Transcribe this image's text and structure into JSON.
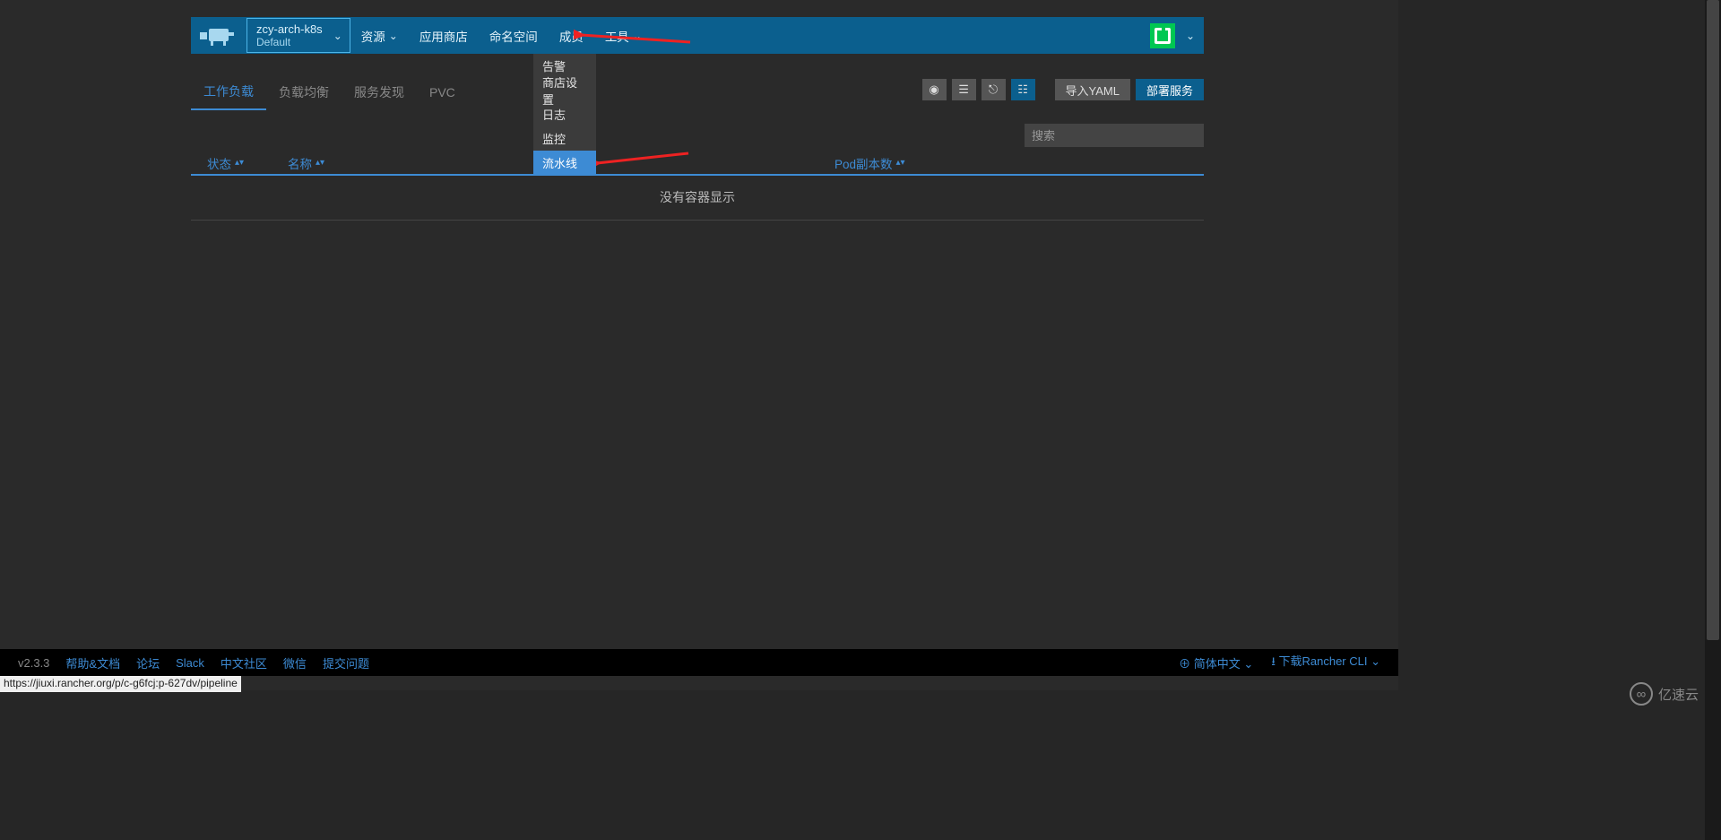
{
  "header": {
    "cluster_name": "zcy-arch-k8s",
    "cluster_sub": "Default",
    "nav": {
      "resources": "资源",
      "app_store": "应用商店",
      "namespace": "命名空间",
      "members": "成员",
      "tools": "工具"
    }
  },
  "tools_dropdown": {
    "alert": "告警",
    "store_settings": "商店设置",
    "logs": "日志",
    "monitor": "监控",
    "pipeline": "流水线"
  },
  "tabs": {
    "workload": "工作负载",
    "load_balance": "负载均衡",
    "service_discovery": "服务发现",
    "pvc": "PVC"
  },
  "actions": {
    "import_yaml": "导入YAML",
    "deploy": "部署服务"
  },
  "search": {
    "placeholder": "搜索"
  },
  "table": {
    "col_status": "状态",
    "col_name": "名称",
    "col_pod": "Pod副本数",
    "empty": "没有容器显示"
  },
  "footer": {
    "version": "v2.3.3",
    "help": "帮助&文档",
    "forum": "论坛",
    "slack": "Slack",
    "cn_community": "中文社区",
    "wechat": "微信",
    "submit_issue": "提交问题",
    "language": "简体中文",
    "download_cli": "下载Rancher CLI"
  },
  "status_url": "https://jiuxi.rancher.org/p/c-g6fcj:p-627dv/pipeline",
  "watermark": "亿速云"
}
